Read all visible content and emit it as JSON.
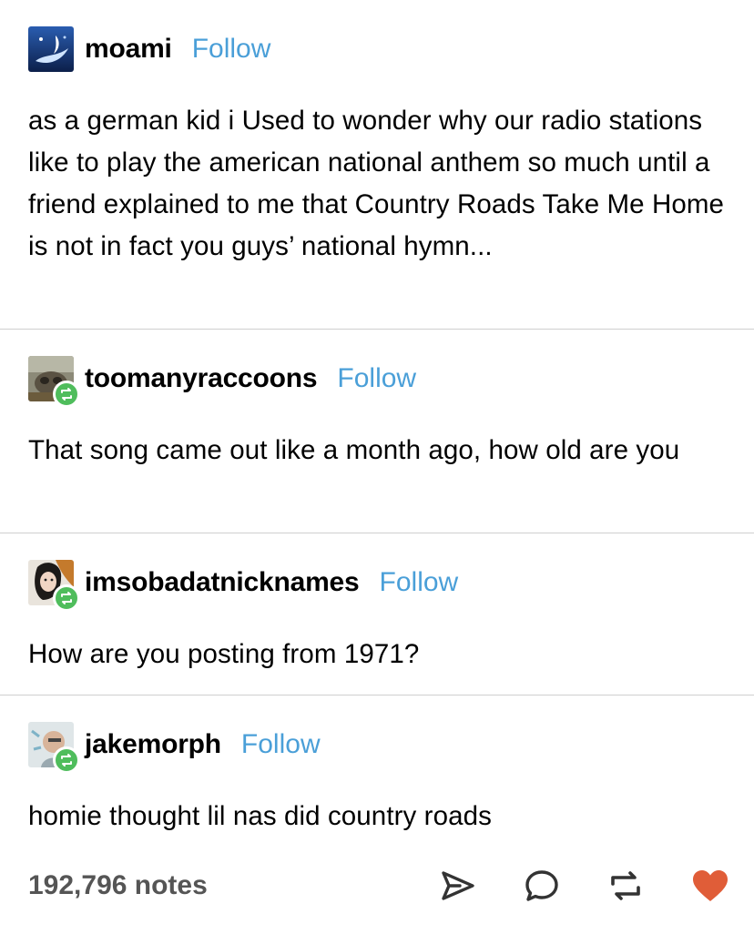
{
  "posts": [
    {
      "username": "moami",
      "follow_label": "Follow",
      "avatar_icon": "avatar-moami",
      "reblogged": false,
      "text": "as a german kid i Used to wonder why our radio stations like to play the american national anthem so much until a friend explained to me that Country Roads Take Me Home is not in fact you guys’ national hymn..."
    },
    {
      "username": "toomanyraccoons",
      "follow_label": "Follow",
      "avatar_icon": "avatar-toomanyraccoons",
      "reblogged": true,
      "text": "That song came out like a month ago, how old are you"
    },
    {
      "username": "imsobadatnicknames",
      "follow_label": "Follow",
      "avatar_icon": "avatar-imsobadatnicknames",
      "reblogged": true,
      "text": "How are you posting from 1971?"
    },
    {
      "username": "jakemorph",
      "follow_label": "Follow",
      "avatar_icon": "avatar-jakemorph",
      "reblogged": true,
      "text": "homie thought lil nas did country roads"
    }
  ],
  "footer": {
    "notes_label": "192,796 notes",
    "actions": [
      "share-icon",
      "reply-icon",
      "reblog-icon",
      "like-icon"
    ]
  },
  "colors": {
    "follow": "#4a9fd8",
    "reblog_badge": "#4fbd5c",
    "like": "#e05d38",
    "divider": "#cfcfcf"
  }
}
